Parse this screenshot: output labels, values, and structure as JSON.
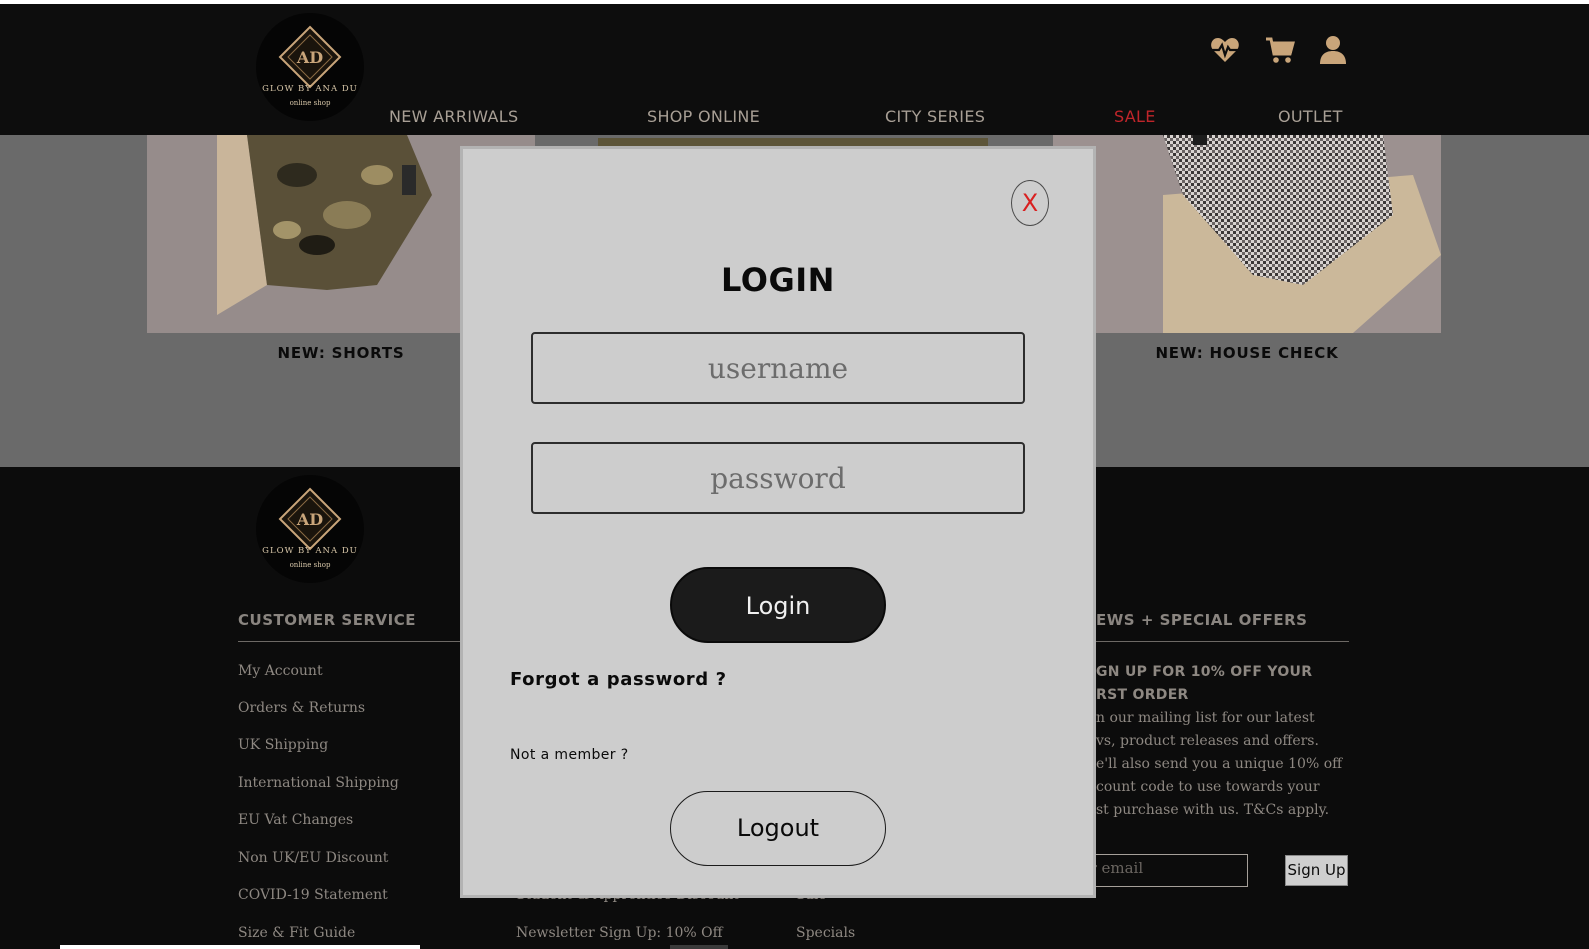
{
  "brand": {
    "logo_line1": "GLOW BY ANA DU",
    "logo_line2": "online shop",
    "logo_monogram": "AD",
    "accent_color": "#c9a57a",
    "sale_color": "#c0252a"
  },
  "header": {
    "nav": [
      {
        "label": "NEW ARRIWALS"
      },
      {
        "label": "SHOP ONLINE"
      },
      {
        "label": "CITY SERIES"
      },
      {
        "label": "SALE"
      },
      {
        "label": "OUTLET"
      }
    ],
    "icons": [
      "heartbeat-icon",
      "cart-icon",
      "user-icon"
    ]
  },
  "products": [
    {
      "label": "NEW: SHORTS"
    },
    {
      "label": "NEW: HOUSE CHECK"
    }
  ],
  "footer": {
    "customer_service": {
      "heading": "CUSTOMER SERVICE",
      "links": [
        "My Account",
        "Orders & Returns",
        "UK Shipping",
        "International Shipping",
        "EU Vat Changes",
        "Non UK/EU Discount",
        "COVID-19 Statement",
        "Size & Fit Guide"
      ]
    },
    "col2_partial": [
      "Student & Apprentice Discount",
      "Newsletter Sign Up: 10% Off"
    ],
    "col3_partial": [
      "Sale",
      "Specials"
    ],
    "newsletter": {
      "heading": "EWS + SPECIAL OFFERS",
      "title_line1": "GN UP FOR 10% OFF YOUR",
      "title_line2": "RST ORDER",
      "body_lines": [
        "n our mailing list for our latest",
        "vs, product releases and offers.",
        "e'll also send you a unique 10% off",
        "count code to use towards your",
        "st purchase with us. T&Cs apply."
      ],
      "email_placeholder": "nter email",
      "signup_label": "Sign Up"
    }
  },
  "modal": {
    "close_label": "X",
    "title": "LOGIN",
    "username_placeholder": "username",
    "password_placeholder": "password",
    "login_label": "Login",
    "forgot_label": "Forgot a password ?",
    "not_member_label": "Not a member ?",
    "logout_label": "Logout"
  }
}
